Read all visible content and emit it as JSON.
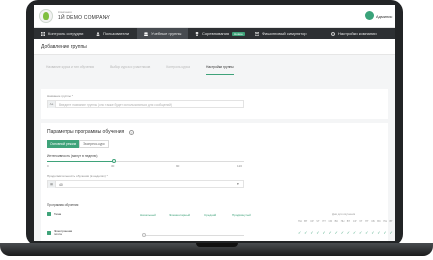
{
  "header": {
    "company_caption": "Компания",
    "company_name": "1Й DEMO COMPANY",
    "user_name": "Админис"
  },
  "nav": {
    "items": [
      {
        "label": "Контроль сотрудни",
        "icon": "grid-icon",
        "active": false
      },
      {
        "label": "Пользователи",
        "icon": "users-icon",
        "active": false
      },
      {
        "label": "Учебные группы",
        "icon": "group-icon",
        "active": true
      },
      {
        "label": "Соревнования",
        "icon": "trophy-icon",
        "active": false,
        "badge": "Новое"
      },
      {
        "label": "Фишинговый симулятор",
        "icon": "phishing-icon",
        "active": false
      },
      {
        "label": "Настройки компании",
        "icon": "gear-icon",
        "active": false
      }
    ]
  },
  "page": {
    "title": "Добавление группы"
  },
  "steps": [
    {
      "label": "Название курса и тип обучения",
      "active": false
    },
    {
      "label": "Выбор курса и участников",
      "active": false
    },
    {
      "label": "Контроль курса",
      "active": false
    },
    {
      "label": "Настройки группы",
      "active": true
    }
  ],
  "group_name": {
    "label": "Название группы *",
    "placeholder": "Введите название группы (оно также будет использоваться для сообщений)"
  },
  "program": {
    "title": "Параметры программы обучения",
    "modes": [
      {
        "label": "Основной режим",
        "selected": true
      },
      {
        "label": "Экспресс-курс",
        "selected": false
      }
    ],
    "intensity_label": "Интенсивность (минут в неделю)",
    "intensity_ticks": [
      "0",
      "30",
      "90",
      "120"
    ],
    "intensity_fraction": 0.34,
    "duration_label": "Продолжительность обучения (в неделях) *",
    "duration_value": "40",
    "chart_title": "Программа обучения",
    "topic_header": "Тема",
    "levels": [
      "Начальный",
      "Элементарный",
      "Средний",
      "Продвинутый"
    ],
    "schedule_header": "Дни для изучения",
    "days": [
      "ПН",
      "ВТ",
      "СР",
      "ЧТ",
      "ПТ",
      "СБ",
      "ВС",
      "ПН",
      "ВТ",
      "СР",
      "ЧТ",
      "ПТ",
      "СБ",
      "ВС",
      "ПН",
      "ВТ"
    ],
    "topic_row": "Электронная почта"
  },
  "colors": {
    "accent": "#3fa37a",
    "nav_bg": "#2d3033",
    "laptop": "#222426"
  }
}
